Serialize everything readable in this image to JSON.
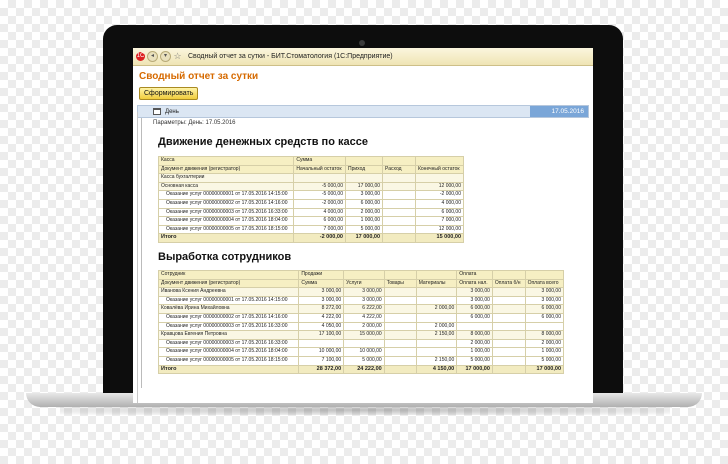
{
  "window": {
    "title": "Сводный отчет за сутки - БИТ.Стоматология (1С:Предприятие)",
    "app_icon": "1C",
    "colors": {
      "heading": "#d66a00",
      "button": "#f0cc3c",
      "selected_date": "#7aa6d8"
    }
  },
  "doc_title": "Сводный отчет за сутки",
  "toolbar": {
    "generate_label": "Сформировать"
  },
  "period": {
    "type": "День",
    "date": "17.05.2016"
  },
  "params_text": "Параметры:  День: 17.05.2016",
  "section1": {
    "title": "Движение денежных средств по кассе",
    "header_row1": [
      "Касса",
      "Сумма",
      "",
      "",
      ""
    ],
    "header_row2": [
      "Документ движения (регистратор)",
      "Начальный остаток",
      "Приход",
      "Расход",
      "Конечный остаток"
    ],
    "rows": [
      {
        "level": 0,
        "cells": [
          "Касса бухгалтерии",
          "",
          "",
          "",
          ""
        ]
      },
      {
        "level": 0,
        "cells": [
          "Основная касса",
          "-5 000,00",
          "17 000,00",
          "",
          "12 000,00"
        ]
      },
      {
        "level": 1,
        "cells": [
          "Оказание услуг 00000000001 от 17.05.2016 14:15:00",
          "-5 000,00",
          "3 000,00",
          "",
          "-2 000,00"
        ]
      },
      {
        "level": 1,
        "cells": [
          "Оказание услуг 00000000002 от 17.05.2016 14:16:00",
          "-2 000,00",
          "6 000,00",
          "",
          "4 000,00"
        ]
      },
      {
        "level": 1,
        "cells": [
          "Оказание услуг 00000000003 от 17.05.2016 16:33:00",
          "4 000,00",
          "2 000,00",
          "",
          "6 000,00"
        ]
      },
      {
        "level": 1,
        "cells": [
          "Оказание услуг 00000000004 от 17.05.2016 18:04:00",
          "6 000,00",
          "1 000,00",
          "",
          "7 000,00"
        ]
      },
      {
        "level": 1,
        "cells": [
          "Оказание услуг 00000000005 от 17.05.2016 18:15:00",
          "7 000,00",
          "5 000,00",
          "",
          "12 000,00"
        ]
      }
    ],
    "total": [
      "Итого",
      "-2 000,00",
      "17 000,00",
      "",
      "15 000,00"
    ]
  },
  "section2": {
    "title": "Выработка сотрудников",
    "header_row1": [
      "Сотрудник",
      "Продажи",
      "",
      "",
      "",
      "Оплата",
      "",
      ""
    ],
    "header_row2": [
      "Документ движения (регистратор)",
      "Сумма",
      "Услуги",
      "Товары",
      "Материалы",
      "Оплата нал.",
      "Оплата б/н",
      "Оплата всего"
    ],
    "rows": [
      {
        "level": 0,
        "cells": [
          "Иванова Ксения Андреевна",
          "3 000,00",
          "3 000,00",
          "",
          "",
          "3 000,00",
          "",
          "3 000,00"
        ]
      },
      {
        "level": 1,
        "cells": [
          "Оказание услуг 00000000001 от 17.05.2016 14:15:00",
          "3 000,00",
          "3 000,00",
          "",
          "",
          "3 000,00",
          "",
          "3 000,00"
        ]
      },
      {
        "level": 0,
        "cells": [
          "Ковалёва Ирина Михайловна",
          "8 272,00",
          "6 222,00",
          "",
          "2 000,00",
          "6 000,00",
          "",
          "6 000,00"
        ]
      },
      {
        "level": 1,
        "cells": [
          "Оказание услуг 00000000002 от 17.05.2016 14:16:00",
          "4 222,00",
          "4 222,00",
          "",
          "",
          "6 000,00",
          "",
          "6 000,00"
        ]
      },
      {
        "level": 1,
        "cells": [
          "Оказание услуг 00000000003 от 17.05.2016 16:33:00",
          "4 050,00",
          "2 000,00",
          "",
          "2 000,00",
          "",
          "",
          ""
        ]
      },
      {
        "level": 0,
        "cells": [
          "Кравцова Евгения Петровна",
          "17 100,00",
          "15 000,00",
          "",
          "2 150,00",
          "8 000,00",
          "",
          "8 000,00"
        ]
      },
      {
        "level": 1,
        "cells": [
          "Оказание услуг 00000000003 от 17.05.2016 16:33:00",
          "",
          "",
          "",
          "",
          "2 000,00",
          "",
          "2 000,00"
        ]
      },
      {
        "level": 1,
        "cells": [
          "Оказание услуг 00000000004 от 17.05.2016 18:04:00",
          "10 000,00",
          "10 000,00",
          "",
          "",
          "1 000,00",
          "",
          "1 000,00"
        ]
      },
      {
        "level": 1,
        "cells": [
          "Оказание услуг 00000000005 от 17.05.2016 18:15:00",
          "7 100,00",
          "5 000,00",
          "",
          "2 150,00",
          "5 000,00",
          "",
          "5 000,00"
        ]
      }
    ],
    "total": [
      "Итого",
      "28 372,00",
      "24 222,00",
      "",
      "4 150,00",
      "17 000,00",
      "",
      "17 000,00"
    ]
  }
}
